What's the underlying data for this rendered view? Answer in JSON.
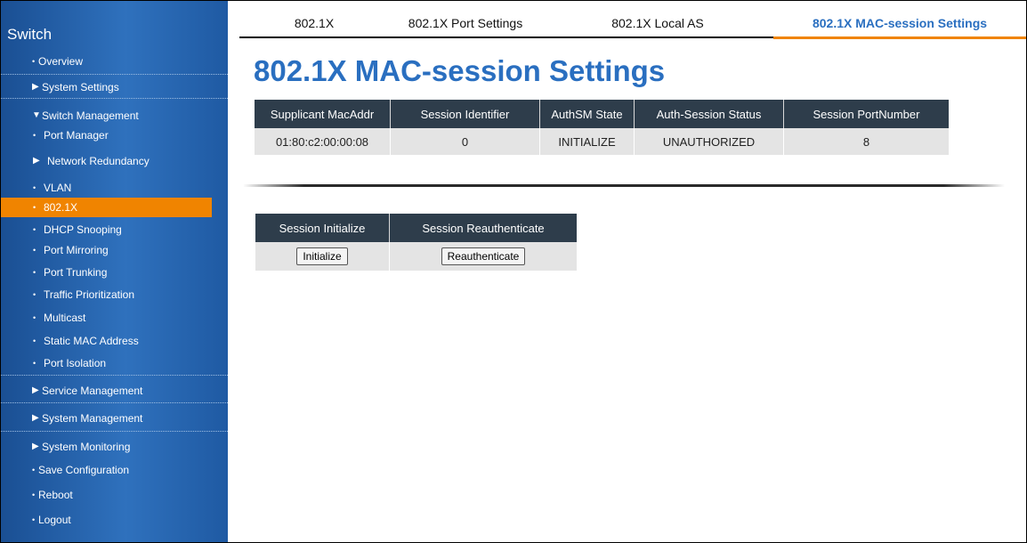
{
  "sidebar": {
    "brand": "Switch",
    "items": [
      {
        "label": "Overview",
        "bullet": "•"
      },
      {
        "label": "System Settings",
        "marker": "▶"
      },
      {
        "label": "Switch Management",
        "marker": "▼"
      },
      {
        "label": "Port Manager",
        "bullet": "•"
      },
      {
        "label": "Network Redundancy",
        "marker": "▶"
      },
      {
        "label": "VLAN",
        "bullet": "•"
      },
      {
        "label": "802.1X",
        "bullet": "•"
      },
      {
        "label": "DHCP Snooping",
        "bullet": "•"
      },
      {
        "label": "Port Mirroring",
        "bullet": "•"
      },
      {
        "label": "Port Trunking",
        "bullet": "•"
      },
      {
        "label": "Traffic Prioritization",
        "bullet": "•"
      },
      {
        "label": "Multicast",
        "bullet": "•"
      },
      {
        "label": "Static MAC Address",
        "bullet": "•"
      },
      {
        "label": "Port Isolation",
        "bullet": "•"
      },
      {
        "label": "Service Management",
        "marker": "▶"
      },
      {
        "label": "System Management",
        "marker": "▶"
      },
      {
        "label": "System Monitoring",
        "marker": "▶"
      },
      {
        "label": "Save Configuration",
        "bullet": "•"
      },
      {
        "label": "Reboot",
        "bullet": "•"
      },
      {
        "label": "Logout",
        "bullet": "•"
      }
    ]
  },
  "tabs": [
    {
      "label": "802.1X"
    },
    {
      "label": "802.1X Port Settings"
    },
    {
      "label": "802.1X Local AS"
    },
    {
      "label": "802.1X MAC-session Settings"
    }
  ],
  "page_title": "802.1X MAC-session Settings",
  "session_table": {
    "headers": [
      "Supplicant MacAddr",
      "Session Identifier",
      "AuthSM State",
      "Auth-Session Status",
      "Session PortNumber"
    ],
    "rows": [
      [
        "01:80:c2:00:00:08",
        "0",
        "INITIALIZE",
        "UNAUTHORIZED",
        "8"
      ]
    ]
  },
  "action_table": {
    "headers": [
      "Session Initialize",
      "Session Reauthenticate"
    ],
    "buttons": [
      "Initialize",
      "Reauthenticate"
    ]
  },
  "colors": {
    "accent": "#f08400",
    "title_blue": "#2a6fc0",
    "header_bg": "#2e3d4b",
    "sidebar_blue": "#2f71bd"
  }
}
